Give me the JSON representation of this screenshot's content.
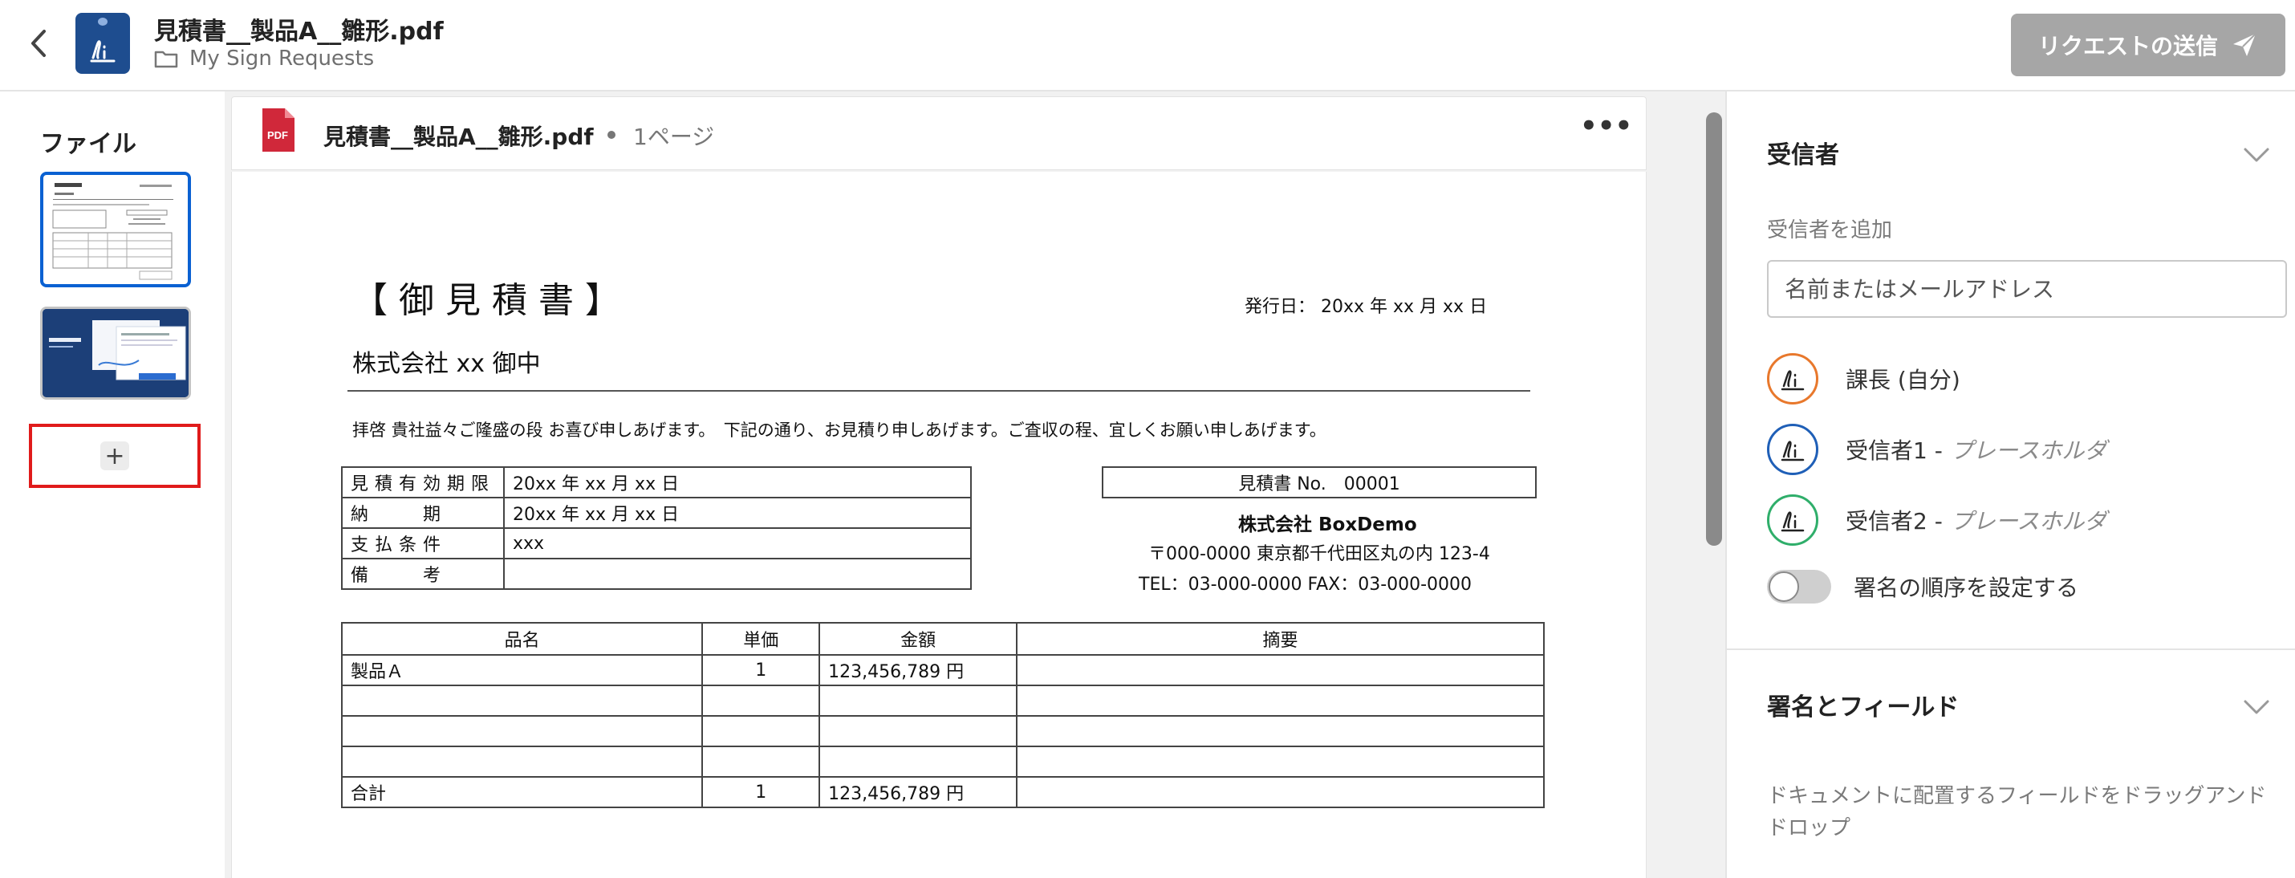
{
  "header": {
    "title": "見積書__製品A__雛形.pdf",
    "folder": "My Sign Requests",
    "send_label": "リクエストの送信"
  },
  "left_panel": {
    "files_label": "ファイル",
    "add_label": "+"
  },
  "document": {
    "name": "見積書__製品A__雛形.pdf",
    "pages": "1ページ",
    "more_label": "•••",
    "content": {
      "title": "【御見積書】",
      "issue_date": "発行日： 20xx 年 xx 月 xx 日",
      "recipient": "株式会社 xx 御中",
      "intro": "拝啓 貴社益々ご隆盛の段 お喜び申しあげます。　下記の通り、お見積り申しあげます。ご査収の程、宜しくお願い申しあげます。",
      "terms": [
        {
          "key": "見積有効期限",
          "value": "20xx 年 xx 月 xx 日"
        },
        {
          "key": "納　　期",
          "value": "20xx 年 xx 月 xx 日"
        },
        {
          "key": "支払条件",
          "value": "xxx"
        },
        {
          "key": "備　　考",
          "value": ""
        }
      ],
      "ref_no": "見積書 No.　00001",
      "issuer_company": "株式会社 BoxDemo",
      "issuer_address": "〒000-0000 東京都千代田区丸の内 123-4",
      "issuer_tel": "TEL：03-000-0000 FAX：03-000-0000",
      "table_headers": [
        "品名",
        "単価",
        "金額",
        "摘要"
      ],
      "rows": [
        [
          "製品Ａ",
          "1",
          "123,456,789 円",
          ""
        ],
        [
          "",
          "",
          "",
          ""
        ],
        [
          "",
          "",
          "",
          ""
        ],
        [
          "",
          "",
          "",
          ""
        ],
        [
          "合計",
          "1",
          "123,456,789 円",
          ""
        ]
      ]
    }
  },
  "right_panel": {
    "recipients_title": "受信者",
    "add_recipient_label": "受信者を追加",
    "input_placeholder": "名前またはメールアドレス",
    "recipients": [
      {
        "name": "課長 (自分)",
        "placeholder": "",
        "color": "#e8782c"
      },
      {
        "name": "受信者1 -",
        "placeholder": "プレースホルダ",
        "color": "#1f5fb7"
      },
      {
        "name": "受信者2 -",
        "placeholder": "プレースホルダ",
        "color": "#2fae6a"
      }
    ],
    "order_toggle_label": "署名の順序を設定する",
    "fields_title": "署名とフィールド",
    "fields_description": "ドキュメントに配置するフィールドをドラッグアンドドロップ"
  }
}
